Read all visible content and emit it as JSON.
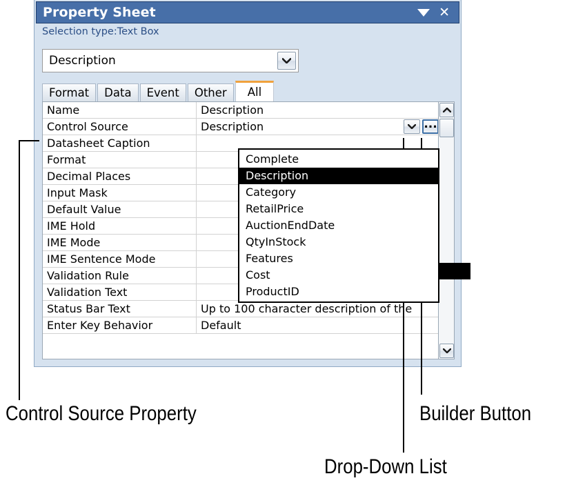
{
  "panel": {
    "title": "Property Sheet",
    "selection_type": "Selection type:Text Box",
    "caret_icon": "caret-down-icon",
    "close_icon": "close-icon",
    "object_selector": {
      "value": "Description",
      "arrow_icon": "chevron-down-icon"
    },
    "tabs": [
      {
        "label": "Format",
        "active": false
      },
      {
        "label": "Data",
        "active": false
      },
      {
        "label": "Event",
        "active": false
      },
      {
        "label": "Other",
        "active": false
      },
      {
        "label": "All",
        "active": true
      }
    ],
    "grid": {
      "rows": [
        {
          "name": "Name",
          "value": "Description"
        },
        {
          "name": "Control Source",
          "value": "Description",
          "active": true
        },
        {
          "name": "Datasheet Caption",
          "value": ""
        },
        {
          "name": "Format",
          "value": ""
        },
        {
          "name": "Decimal Places",
          "value": ""
        },
        {
          "name": "Input Mask",
          "value": ""
        },
        {
          "name": "Default Value",
          "value": ""
        },
        {
          "name": "IME Hold",
          "value": ""
        },
        {
          "name": "IME Mode",
          "value": ""
        },
        {
          "name": "IME Sentence Mode",
          "value": ""
        },
        {
          "name": "Validation Rule",
          "value": ""
        },
        {
          "name": "Validation Text",
          "value": ""
        },
        {
          "name": "Status Bar Text",
          "value": "Up to 100 character description of the"
        },
        {
          "name": "Enter Key Behavior",
          "value": "Default"
        }
      ],
      "control_source_buttons": {
        "dropdown_icon": "chevron-down-icon",
        "builder_label": "...",
        "builder_icon": "ellipsis-icon"
      },
      "dropdown_options": [
        {
          "label": "Complete",
          "selected": false
        },
        {
          "label": "Description",
          "selected": true
        },
        {
          "label": "Category",
          "selected": false
        },
        {
          "label": "RetailPrice",
          "selected": false
        },
        {
          "label": "AuctionEndDate",
          "selected": false
        },
        {
          "label": "QtyInStock",
          "selected": false
        },
        {
          "label": "Features",
          "selected": false
        },
        {
          "label": "Cost",
          "selected": false
        },
        {
          "label": "ProductID",
          "selected": false
        }
      ],
      "scrollbar": {
        "up_icon": "scroll-up-arrow-icon",
        "down_icon": "scroll-down-arrow-icon",
        "thumb": "scrollbar-thumb"
      }
    }
  },
  "annotations": [
    {
      "label": "Control Source Property"
    },
    {
      "label": "Drop-Down List"
    },
    {
      "label": "Builder Button"
    }
  ],
  "colors": {
    "title_bar": "#476fa8",
    "panel_bg": "#d6e2ef",
    "tab_active_accent": "#f0a23c",
    "selection_highlight": "#000000",
    "builder_border": "#3b6ea5"
  }
}
